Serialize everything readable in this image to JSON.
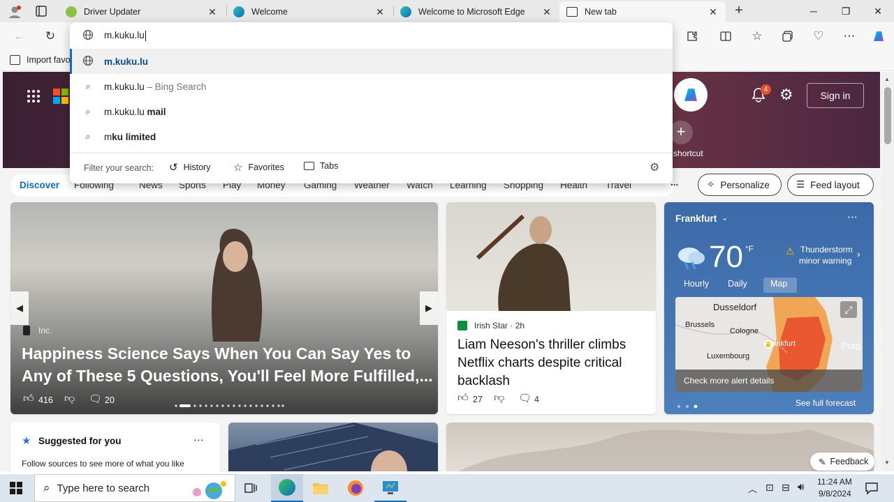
{
  "tabs": [
    {
      "title": "Driver Updater",
      "icon": "driver-updater-icon"
    },
    {
      "title": "Welcome",
      "icon": "edge-icon"
    },
    {
      "title": "Welcome to Microsoft Edge",
      "icon": "edge-icon"
    },
    {
      "title": "New tab",
      "icon": "new-tab-page-icon",
      "active": true
    }
  ],
  "omnibox": {
    "value": "m.kuku.lu",
    "suggestions": [
      {
        "icon": "globe-icon",
        "bold": "m.kuku.lu",
        "rest": "",
        "selected": true
      },
      {
        "icon": "search-icon",
        "plain": "m.kuku.lu",
        "muted": " – Bing Search"
      },
      {
        "icon": "search-icon",
        "plain": "m.kuku.lu ",
        "bold": "mail"
      },
      {
        "icon": "search-icon",
        "plain": "m",
        "bold": "ku limited"
      }
    ],
    "filter_label": "Filter your search:",
    "filters": [
      "History",
      "Favorites",
      "Tabs"
    ]
  },
  "favorites_bar": {
    "import": "Import favo"
  },
  "hero": {
    "sign_in": "Sign in",
    "notifications_count": "4",
    "shortcut_label": "shortcut"
  },
  "feed_nav": {
    "items": [
      "Discover",
      "Following",
      "News",
      "Sports",
      "Play",
      "Money",
      "Gaming",
      "Weather",
      "Watch",
      "Learning",
      "Shopping",
      "Health",
      "Travel"
    ],
    "more": "...",
    "personalize": "Personalize",
    "feed_layout": "Feed layout"
  },
  "main_card": {
    "source": "Inc.",
    "headline": "Happiness Science Says When You Can Say Yes to Any of These 5 Questions, You'll Feel More Fulfilled,...",
    "likes": "416",
    "comments": "20"
  },
  "news_card": {
    "source": "Irish Star",
    "age": "2h",
    "headline": "Liam Neeson's thriller climbs Netflix charts despite critical backlash",
    "likes": "27",
    "comments": "4"
  },
  "weather": {
    "location": "Frankfurt",
    "temp": "70",
    "unit": "°F",
    "alert_line1": "Thunderstorm",
    "alert_line2": "minor warning",
    "tabs": [
      "Hourly",
      "Daily",
      "Map"
    ],
    "map_labels": [
      "Dusseldorf",
      "Brussels",
      "Cologne",
      "Luxembourg",
      "Frankfurt",
      "Prag"
    ],
    "check_alerts": "Check more alert details",
    "see_forecast": "See full forecast"
  },
  "suggested": {
    "title": "Suggested for you",
    "text": "Follow sources to see more of what you like"
  },
  "feedback": "Feedback",
  "taskbar": {
    "search_placeholder": "Type here to search",
    "time": "11:24 AM",
    "date": "9/8/2024"
  },
  "colors": {
    "accent": "#0f6cbd",
    "tab_strip": "#e9e9e9",
    "toolbar": "#f7f7f7",
    "alert_red": "#e8502e",
    "alert_orange": "#f29a3c"
  }
}
